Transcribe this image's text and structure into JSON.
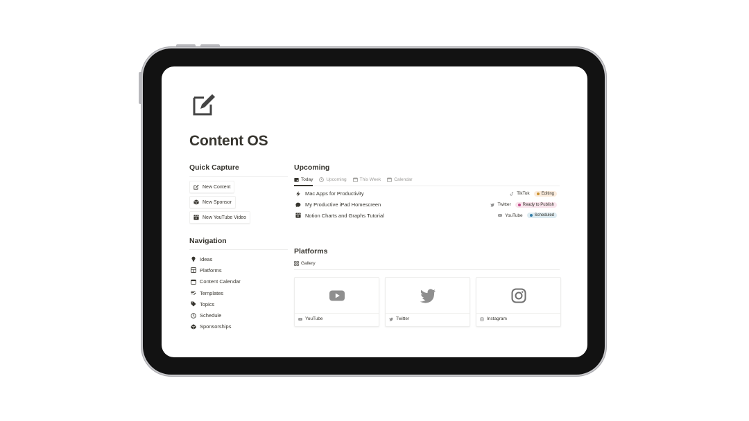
{
  "page": {
    "title": "Content OS",
    "icon": "edit-note-icon"
  },
  "quick_capture": {
    "heading": "Quick Capture",
    "buttons": [
      {
        "label": "New Content",
        "icon": "edit-icon"
      },
      {
        "label": "New Sponsor",
        "icon": "cube-icon"
      },
      {
        "label": "New YouTube Video",
        "icon": "video-icon"
      }
    ]
  },
  "navigation": {
    "heading": "Navigation",
    "items": [
      {
        "label": "Ideas",
        "icon": "lightbulb-icon"
      },
      {
        "label": "Platforms",
        "icon": "layout-icon"
      },
      {
        "label": "Content Calendar",
        "icon": "calendar-icon"
      },
      {
        "label": "Templates",
        "icon": "list-edit-icon"
      },
      {
        "label": "Topics",
        "icon": "tag-icon"
      },
      {
        "label": "Schedule",
        "icon": "clock-icon"
      },
      {
        "label": "Sponsorships",
        "icon": "cube-icon"
      }
    ]
  },
  "upcoming": {
    "heading": "Upcoming",
    "tabs": [
      {
        "label": "Today",
        "icon": "calendar-fill-icon",
        "active": true
      },
      {
        "label": "Upcoming",
        "icon": "clock-icon",
        "active": false
      },
      {
        "label": "This Week",
        "icon": "calendar-icon",
        "active": false
      },
      {
        "label": "Calendar",
        "icon": "calendar-icon",
        "active": false
      }
    ],
    "rows": [
      {
        "title": "Mac Apps for Productivity",
        "icon": "bolt-icon",
        "platform": "TikTok",
        "platform_icon": "tiktok-icon",
        "status": "Editing",
        "status_bg": "#fbecdd",
        "status_dot": "#cb912f"
      },
      {
        "title": "My Productive iPad Homescreen",
        "icon": "chat-bubble-icon",
        "platform": "Twitter",
        "platform_icon": "twitter-icon",
        "status": "Ready to Publish",
        "status_bg": "#f9e4ec",
        "status_dot": "#c14c8a"
      },
      {
        "title": "Notion Charts and Graphs Tutorial",
        "icon": "video-icon",
        "platform": "YouTube",
        "platform_icon": "youtube-icon",
        "status": "Scheduled",
        "status_bg": "#ddebf1",
        "status_dot": "#337ea9"
      }
    ]
  },
  "platforms": {
    "heading": "Platforms",
    "view": "Gallery",
    "cards": [
      {
        "label": "YouTube",
        "icon": "youtube-icon"
      },
      {
        "label": "Twitter",
        "icon": "twitter-icon"
      },
      {
        "label": "Instagram",
        "icon": "instagram-icon"
      }
    ]
  },
  "colors": {
    "text": "#37352f",
    "muted": "#9b9a97",
    "divider": "#ededec",
    "icon_gray": "#8f8f8f"
  }
}
